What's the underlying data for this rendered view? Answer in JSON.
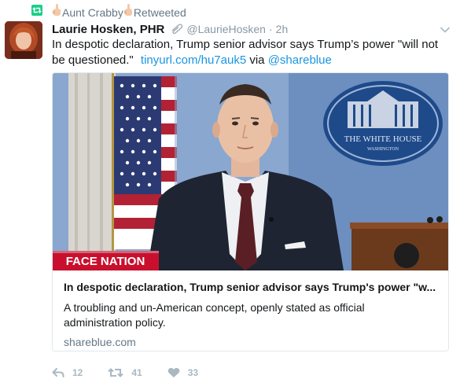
{
  "retweet_context": {
    "retweeter_name": "Aunt Crabby",
    "action_label": "Retweeted"
  },
  "tweet": {
    "display_name": "Laurie Hosken, PHR",
    "handle": "@LaurieHosken",
    "separator": "·",
    "time": "2h",
    "text_main": "In despotic declaration, Trump senior advisor says Trump’s power \"will not be questioned.\"",
    "link_text": "tinyurl.com/hu7auk5",
    "via_text": "via",
    "mention_text": "@shareblue"
  },
  "card": {
    "image_overlay_label": "FACE NATION",
    "podium_seal_text": "THE WHITE HOUSE",
    "podium_seal_subtext": "WASHINGTON",
    "title": "In despotic declaration, Trump senior advisor says Trump's power \"w...",
    "description": "A troubling and un-American concept, openly stated as official administration policy.",
    "domain": "shareblue.com"
  },
  "actions": {
    "reply_count": "12",
    "retweet_count": "41",
    "like_count": "33"
  },
  "colors": {
    "link": "#1b95e0",
    "retweet_green": "#19cf86",
    "muted": "#657786",
    "action_gray": "#aab8c2"
  }
}
